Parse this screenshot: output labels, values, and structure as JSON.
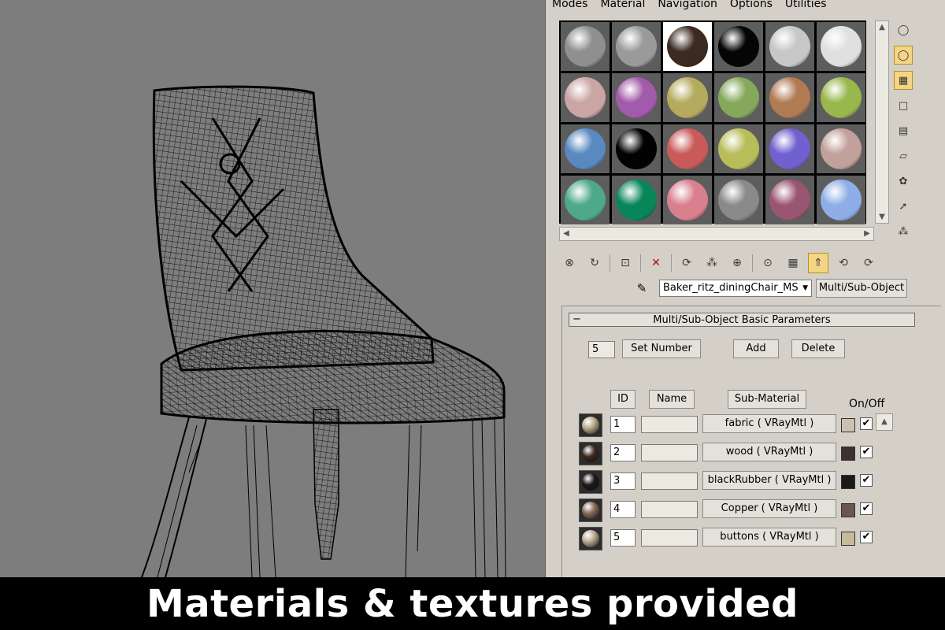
{
  "menu": [
    "Modes",
    "Material",
    "Navigation",
    "Options",
    "Utilities"
  ],
  "slots": [
    {
      "color": "#8f8f8f",
      "icon": "sample-sphere-gray"
    },
    {
      "color": "#9a9a9a",
      "icon": "sample-sphere-wire"
    },
    {
      "color": "#3a2a20",
      "icon": "sample-sphere-copper"
    },
    {
      "color": "#050505",
      "icon": "sample-sphere-black"
    },
    {
      "color": "#c7c7c7",
      "icon": "sample-sphere-white"
    },
    {
      "color": "#e0e0e0",
      "icon": "sample-sphere-checker"
    },
    {
      "color": "#c9a5a3",
      "icon": "sample-sphere"
    },
    {
      "color": "#a25aaa",
      "icon": "sample-sphere"
    },
    {
      "color": "#b5ab5e",
      "icon": "sample-sphere"
    },
    {
      "color": "#86a85b",
      "icon": "sample-sphere"
    },
    {
      "color": "#b07a53",
      "icon": "sample-sphere"
    },
    {
      "color": "#98b74d",
      "icon": "sample-sphere"
    },
    {
      "color": "#5a88c0",
      "icon": "sample-sphere"
    },
    {
      "color": "#020202",
      "icon": "sample-sphere"
    },
    {
      "color": "#c95a5a",
      "icon": "sample-sphere"
    },
    {
      "color": "#b8bd5a",
      "icon": "sample-sphere"
    },
    {
      "color": "#7060d0",
      "icon": "sample-sphere"
    },
    {
      "color": "#c2a09c",
      "icon": "sample-sphere"
    },
    {
      "color": "#4ea98a",
      "icon": "sample-sphere"
    },
    {
      "color": "#08865a",
      "icon": "sample-sphere"
    },
    {
      "color": "#d9808f",
      "icon": "sample-sphere"
    },
    {
      "color": "#8a8a8a",
      "icon": "sample-sphere"
    },
    {
      "color": "#9a5572",
      "icon": "sample-sphere"
    },
    {
      "color": "#8faee8",
      "icon": "sample-sphere"
    }
  ],
  "active_slot": 2,
  "material_name": "Baker_ritz_diningChair_MS",
  "material_type": "Multi/Sub-Object",
  "rollout_title": "Multi/Sub-Object Basic Parameters",
  "count": "5",
  "buttons": {
    "set_number": "Set Number",
    "add": "Add",
    "delete": "Delete"
  },
  "headers": {
    "id": "ID",
    "name": "Name",
    "sub": "Sub-Material",
    "onoff": "On/Off"
  },
  "rows": [
    {
      "id": "1",
      "sub": "fabric  ( VRayMtl )",
      "swatch": "#cfbfae",
      "ball": "#b9ab8e"
    },
    {
      "id": "2",
      "sub": "wood  ( VRayMtl )",
      "swatch": "#3d3130",
      "ball": "#3a2a20"
    },
    {
      "id": "3",
      "sub": "blackRubber  ( VRayMtl )",
      "swatch": "#1a1a1a",
      "ball": "#1a1a1a"
    },
    {
      "id": "4",
      "sub": "Copper  ( VRayMtl )",
      "swatch": "#6a5650",
      "ball": "#8a6a5a"
    },
    {
      "id": "5",
      "sub": "buttons  ( VRayMtl )",
      "swatch": "#c7b99a",
      "ball": "#b9ab8e"
    }
  ],
  "caption": "Materials & textures provided"
}
